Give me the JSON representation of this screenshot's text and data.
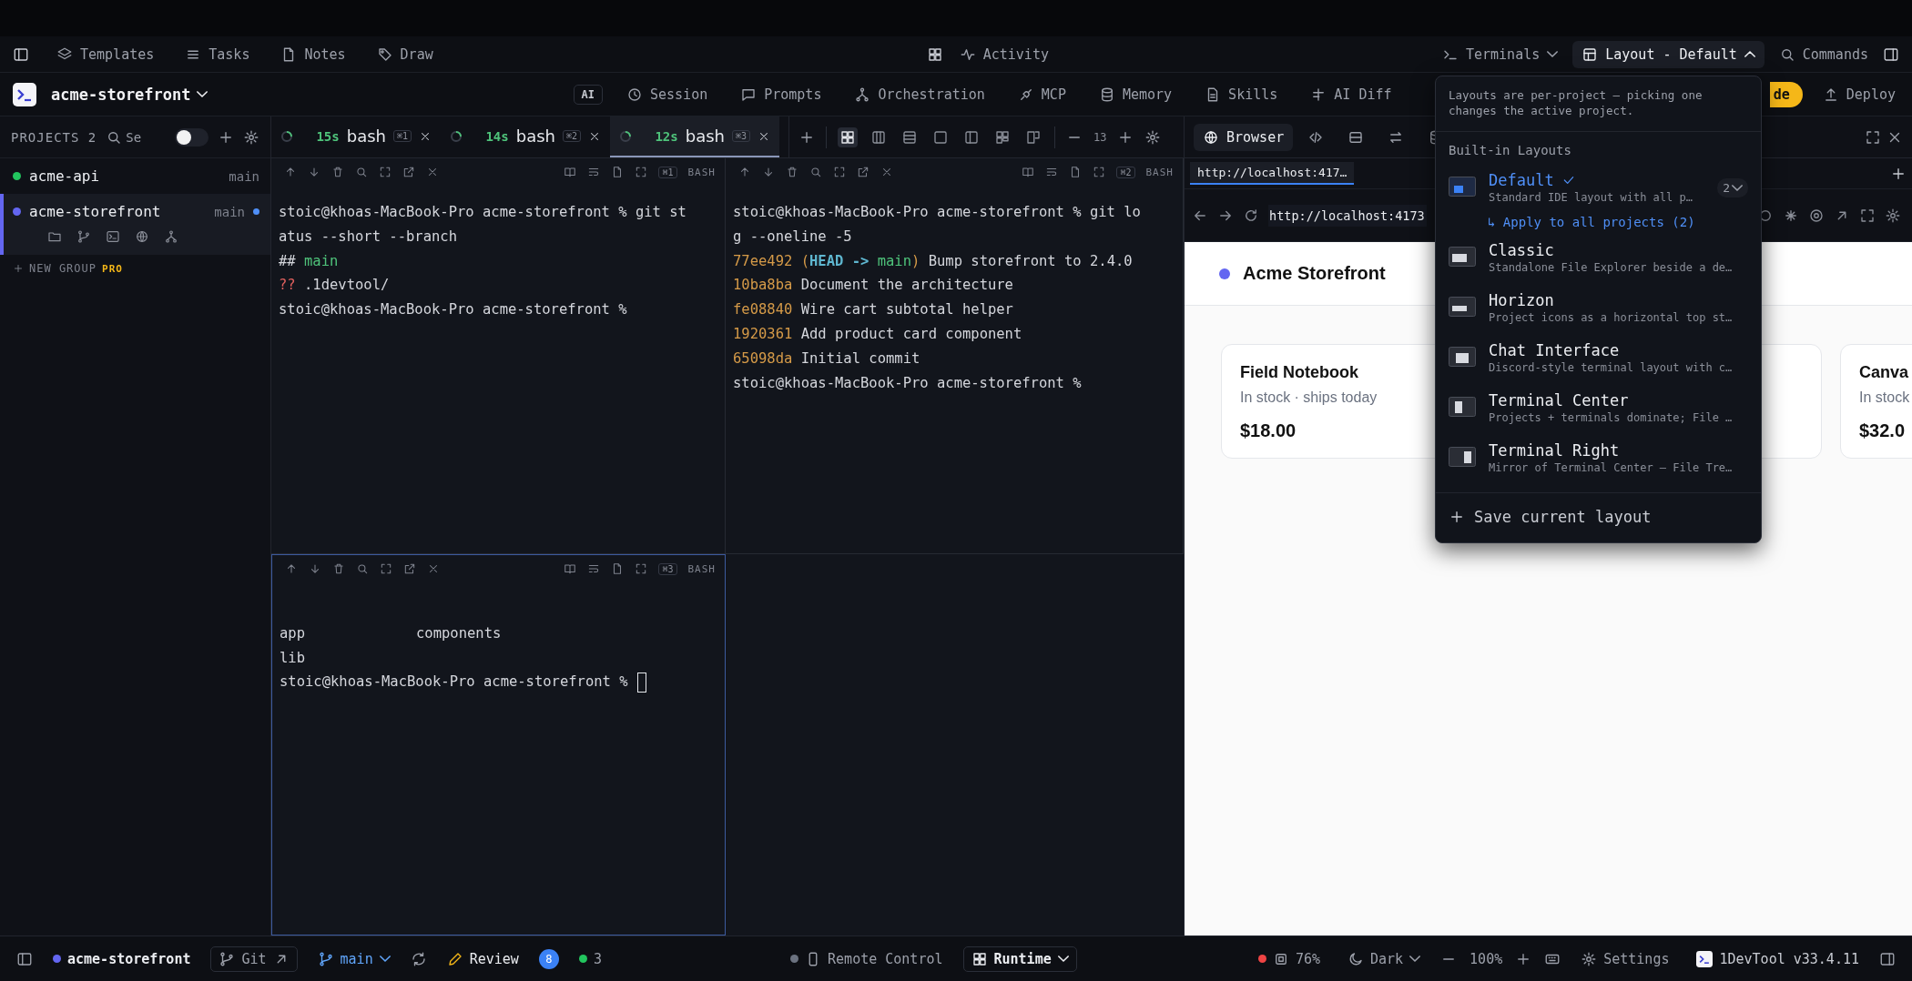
{
  "top_bar": {
    "nav": [
      {
        "label": "Templates"
      },
      {
        "label": "Tasks"
      },
      {
        "label": "Notes"
      },
      {
        "label": "Draw"
      }
    ],
    "activity": {
      "label": "Activity"
    },
    "terminals_menu": {
      "label": "Terminals",
      "expanded": false
    },
    "layout_menu": {
      "label": "Layout - Default",
      "expanded": true
    },
    "commands": {
      "label": "Commands"
    }
  },
  "project_bar": {
    "project": {
      "name": "acme-storefront"
    },
    "ai_badge": "AI",
    "tools": [
      {
        "label": "Session"
      },
      {
        "label": "Prompts"
      },
      {
        "label": "Orchestration"
      },
      {
        "label": "MCP"
      },
      {
        "label": "Memory"
      },
      {
        "label": "Skills"
      },
      {
        "label": "AI Diff"
      }
    ],
    "upgrade_button": {
      "label": "de"
    },
    "deploy_button": {
      "label": "Deploy"
    }
  },
  "sidebar": {
    "title": "PROJECTS 2",
    "search": {
      "placeholder": "Se"
    },
    "toggle": {
      "on": false
    },
    "projects": [
      {
        "name": "acme-api",
        "branch": "main",
        "color": "#22c55e",
        "selected": false,
        "modified": false
      },
      {
        "name": "acme-storefront",
        "branch": "main",
        "color": "#6366f1",
        "selected": true,
        "modified": true
      }
    ],
    "new_group": {
      "label": "NEW GROUP",
      "badge": "PRO"
    }
  },
  "terminals": {
    "tabs": [
      {
        "elapsed": "15s",
        "title": "bash",
        "shortcut": "⌘1",
        "selected": false
      },
      {
        "elapsed": "14s",
        "title": "bash",
        "shortcut": "⌘2",
        "selected": false
      },
      {
        "elapsed": "12s",
        "title": "bash",
        "shortcut": "⌘3",
        "selected": true
      }
    ],
    "layout_options": [
      {
        "selected": true
      },
      {
        "selected": false
      },
      {
        "selected": false
      },
      {
        "selected": false
      },
      {
        "selected": false
      },
      {
        "selected": false
      },
      {
        "selected": false
      }
    ],
    "font_size": "13",
    "panes": [
      {
        "shortcut": "⌘1",
        "shell": "BASH",
        "focused": false,
        "lines": [
          {
            "kind": "text",
            "segments": [
              {
                "text": "stoic@khoas-MacBook-Pro acme-storefront % git st",
                "kind": "plain"
              }
            ]
          },
          {
            "kind": "text",
            "segments": [
              {
                "text": "atus --short --branch",
                "kind": "plain"
              }
            ]
          },
          {
            "kind": "text",
            "segments": [
              {
                "text": "## ",
                "kind": "plain"
              },
              {
                "text": "main",
                "kind": "green"
              }
            ]
          },
          {
            "kind": "text",
            "segments": [
              {
                "text": "?? ",
                "kind": "red"
              },
              {
                "text": ".1devtool/",
                "kind": "plain"
              }
            ]
          },
          {
            "kind": "text",
            "segments": [
              {
                "text": "stoic@khoas-MacBook-Pro acme-storefront %",
                "kind": "plain"
              }
            ]
          }
        ]
      },
      {
        "shortcut": "⌘2",
        "shell": "BASH",
        "focused": false,
        "lines": [
          {
            "kind": "text",
            "segments": [
              {
                "text": "stoic@khoas-MacBook-Pro acme-storefront % git lo",
                "kind": "plain"
              }
            ]
          },
          {
            "kind": "text",
            "segments": [
              {
                "text": "g --oneline -5",
                "kind": "plain"
              }
            ]
          },
          {
            "kind": "text",
            "segments": [
              {
                "text": "77ee492 (",
                "kind": "orange"
              },
              {
                "text": "HEAD -> ",
                "kind": "cyan"
              },
              {
                "text": "main",
                "kind": "green"
              },
              {
                "text": ")",
                "kind": "orange"
              },
              {
                "text": " Bump storefront to 2.4.0",
                "kind": "plain"
              }
            ]
          },
          {
            "kind": "text",
            "segments": [
              {
                "text": "10ba8ba",
                "kind": "orange"
              },
              {
                "text": " Document the architecture",
                "kind": "plain"
              }
            ]
          },
          {
            "kind": "text",
            "segments": [
              {
                "text": "fe08840",
                "kind": "orange"
              },
              {
                "text": " Wire cart subtotal helper",
                "kind": "plain"
              }
            ]
          },
          {
            "kind": "text",
            "segments": [
              {
                "text": "1920361",
                "kind": "orange"
              },
              {
                "text": " Add product card component",
                "kind": "plain"
              }
            ]
          },
          {
            "kind": "text",
            "segments": [
              {
                "text": "65098da",
                "kind": "orange"
              },
              {
                "text": " Initial commit",
                "kind": "plain"
              }
            ]
          },
          {
            "kind": "text",
            "segments": [
              {
                "text": "stoic@khoas-MacBook-Pro acme-storefront %",
                "kind": "plain"
              }
            ]
          }
        ]
      },
      {
        "shortcut": "⌘3",
        "shell": "BASH",
        "focused": true,
        "lines": [
          {
            "kind": "blank"
          },
          {
            "kind": "columns",
            "segments": [
              {
                "text": "app",
                "kind": "plain"
              },
              {
                "text": "components",
                "kind": "plain"
              }
            ]
          },
          {
            "kind": "text",
            "segments": [
              {
                "text": "lib",
                "kind": "plain"
              }
            ]
          },
          {
            "kind": "text",
            "cursor": true,
            "segments": [
              {
                "text": "stoic@khoas-MacBook-Pro acme-storefront %",
                "kind": "plain"
              }
            ]
          }
        ]
      }
    ]
  },
  "browser": {
    "view_tabs": [
      {
        "label": "Browser",
        "selected": true
      },
      {
        "selected": false
      },
      {
        "selected": false
      },
      {
        "selected": false
      },
      {
        "selected": false
      }
    ],
    "page_tabs": [
      {
        "label": "http://localhost:417…",
        "selected": true
      }
    ],
    "address": {
      "value": "http://localhost:4173"
    },
    "page": {
      "site_title": "Acme Storefront",
      "cards": [
        {
          "kind": "product",
          "name": "Field Notebook",
          "detail": "In stock · ships today",
          "price": "$18.00"
        },
        {
          "kind": "covered"
        },
        {
          "kind": "product",
          "name": "Canva",
          "detail": "In stock",
          "price": "$32.0"
        }
      ]
    }
  },
  "layout_dropdown": {
    "note": "Layouts are per-project — picking one changes the active project.",
    "section": "Built-in Layouts",
    "layouts": [
      {
        "name": "Default",
        "description": "Standard IDE layout with all p…",
        "selected": true,
        "count": "2",
        "apply_label": "↳ Apply to all projects (2)"
      },
      {
        "name": "Classic",
        "description": "Standalone File Explorer beside a de…",
        "selected": false
      },
      {
        "name": "Horizon",
        "description": "Project icons as a horizontal top st…",
        "selected": false
      },
      {
        "name": "Chat Interface",
        "description": "Discord-style terminal layout with c…",
        "selected": false
      },
      {
        "name": "Terminal Center",
        "description": "Projects + terminals dominate; File …",
        "selected": false
      },
      {
        "name": "Terminal Right",
        "description": "Mirror of Terminal Center — File Tre…",
        "selected": false
      }
    ],
    "save_label": "Save current layout"
  },
  "status_bar": {
    "project": {
      "name": "acme-storefront",
      "color": "#6366f1"
    },
    "git": {
      "label": "Git"
    },
    "branch": {
      "label": "main"
    },
    "review": {
      "label": "Review",
      "count": "8"
    },
    "processes": {
      "count": "3",
      "color": "#22c55e"
    },
    "remote_control": {
      "label": "Remote Control",
      "color": "#6b7280"
    },
    "runtime": {
      "label": "Runtime"
    },
    "memory": {
      "label": "76%",
      "color": "#ef4444"
    },
    "theme": {
      "label": "Dark"
    },
    "zoom": {
      "label": "100%"
    },
    "settings": {
      "label": "Settings"
    },
    "version": {
      "label": "1DevTool v33.4.11"
    }
  }
}
